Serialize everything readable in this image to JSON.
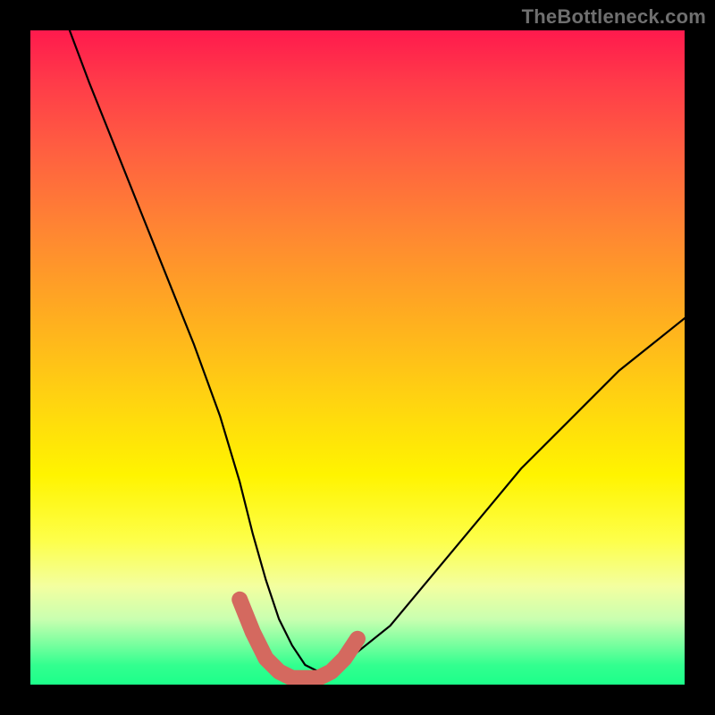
{
  "watermark": "TheBottleneck.com",
  "chart_data": {
    "type": "line",
    "title": "",
    "xlabel": "",
    "ylabel": "",
    "xlim": [
      0,
      100
    ],
    "ylim": [
      0,
      100
    ],
    "grid": false,
    "series": [
      {
        "name": "bottleneck-curve",
        "x": [
          6,
          9,
          13,
          17,
          21,
          25,
          29,
          32,
          34,
          36,
          38,
          40,
          42,
          44,
          46,
          48,
          50,
          55,
          60,
          65,
          70,
          75,
          80,
          85,
          90,
          95,
          100
        ],
        "values": [
          100,
          92,
          82,
          72,
          62,
          52,
          41,
          31,
          23,
          16,
          10,
          6,
          3,
          2,
          2,
          3,
          5,
          9,
          15,
          21,
          27,
          33,
          38,
          43,
          48,
          52,
          56
        ]
      }
    ],
    "highlight_segment": {
      "color": "#d4695f",
      "x": [
        32,
        34,
        36,
        38,
        40,
        42,
        44,
        46,
        48,
        50
      ],
      "values": [
        13,
        8,
        4,
        2,
        1,
        1,
        1,
        2,
        4,
        7
      ]
    },
    "colors": {
      "curve": "#000000",
      "highlight": "#d4695f",
      "frame": "#000000"
    }
  }
}
